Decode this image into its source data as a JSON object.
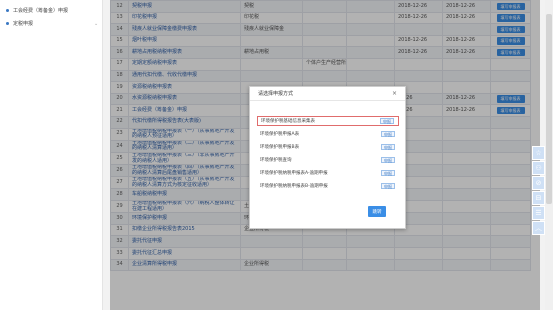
{
  "sidebar": [
    {
      "label": "工会经费（筹备金）申报",
      "chevron": ""
    },
    {
      "label": "定税申报",
      "chevron": "⌄"
    }
  ],
  "rows": [
    {
      "num": "12",
      "name": "契税申报",
      "mid": "契税",
      "mid2": "",
      "d1": "2018-12-26",
      "d2": "2018-12-26",
      "btn": "填写申报表"
    },
    {
      "num": "13",
      "name": "印花税申报",
      "mid": "印花税",
      "mid2": "",
      "d1": "2018-12-26",
      "d2": "2018-12-26",
      "btn": "填写申报表"
    },
    {
      "num": "14",
      "name": "残疾人就业保障金缴费申报表",
      "mid": "残疾人就业保障金",
      "mid2": "",
      "d1": "",
      "d2": "",
      "btn": "填写申报表"
    },
    {
      "num": "15",
      "name": "烟叶税申报",
      "mid": "",
      "mid2": "",
      "d1": "2018-12-26",
      "d2": "2018-12-26",
      "btn": "填写申报表"
    },
    {
      "num": "16",
      "name": "耕地占用税纳税申报表",
      "mid": "耕地占用税",
      "mid2": "",
      "d1": "2018-12-26",
      "d2": "2018-12-26",
      "btn": "填写申报表"
    },
    {
      "num": "17",
      "name": "定期定额纳税申报表",
      "mid": "",
      "mid2": "个体户生产经营所得",
      "d1": "",
      "d2": "",
      "btn": ""
    },
    {
      "num": "18",
      "name": "通用代扣代缴、代收代缴申报",
      "mid": "",
      "mid2": "",
      "d1": "",
      "d2": "",
      "btn": ""
    },
    {
      "num": "19",
      "name": "资源税纳税申报表",
      "mid": "",
      "mid2": "",
      "d1": "",
      "d2": "",
      "btn": ""
    },
    {
      "num": "20",
      "name": "水资源税纳税申报表",
      "mid": "",
      "mid2": "",
      "d1": "12-26",
      "d2": "2018-12-26",
      "btn": "填写申报表"
    },
    {
      "num": "21",
      "name": "工会经费（筹备金）申报",
      "mid": "",
      "mid2": "",
      "d1": "12-26",
      "d2": "2018-12-26",
      "btn": "填写申报表"
    },
    {
      "num": "22",
      "name": "代扣代缴所得税报告表(大表版)",
      "mid": "",
      "mid2": "",
      "d1": "",
      "d2": "",
      "btn": ""
    },
    {
      "num": "23",
      "name": "土地增值税纳税申报表（一）（从事房地产开发的纳税人预征适用）",
      "mid": "",
      "mid2": "",
      "d1": "",
      "d2": "",
      "btn": ""
    },
    {
      "num": "24",
      "name": "土地增值税纳税申报表（二）（从事房地产开发的纳税人清算适用）",
      "mid": "",
      "mid2": "",
      "d1": "",
      "d2": "",
      "btn": ""
    },
    {
      "num": "25",
      "name": "土地增值税纳税申报表（三）（非从事房地产开发的纳税人适用）",
      "mid": "",
      "mid2": "",
      "d1": "",
      "d2": "",
      "btn": ""
    },
    {
      "num": "26",
      "name": "土地增值税纳税申报表（四）（从事房地产开发的纳税人清算后尾盘销售适用）",
      "mid": "",
      "mid2": "",
      "d1": "",
      "d2": "",
      "btn": ""
    },
    {
      "num": "27",
      "name": "土地增值税纳税申报表（五）（从事房地产开发的纳税人清算方式为核定征收适用）",
      "mid": "",
      "mid2": "",
      "d1": "",
      "d2": "",
      "btn": ""
    },
    {
      "num": "28",
      "name": "车船税纳税申报",
      "mid": "",
      "mid2": "",
      "d1": "",
      "d2": "",
      "btn": ""
    },
    {
      "num": "29",
      "name": "土地增值税纳税申报表（六）（纳税人整体转让在建工程适用）",
      "mid": "土地增值税",
      "mid2": "整体转让在建工程",
      "d1": "",
      "d2": "",
      "btn": ""
    },
    {
      "num": "30",
      "name": "环境保护税申报",
      "mid": "环境保护税",
      "mid2": "",
      "d1": "",
      "d2": "",
      "btn": ""
    },
    {
      "num": "31",
      "name": "扣缴企业所得税报告表2015",
      "mid": "企业所得税",
      "mid2": "",
      "d1": "",
      "d2": "",
      "btn": ""
    },
    {
      "num": "32",
      "name": "委托代征申报",
      "mid": "",
      "mid2": "",
      "d1": "",
      "d2": "",
      "btn": ""
    },
    {
      "num": "33",
      "name": "委托代征汇总申报",
      "mid": "",
      "mid2": "",
      "d1": "",
      "d2": "",
      "btn": ""
    },
    {
      "num": "34",
      "name": "企业清算所得税申报",
      "mid": "企业所得税",
      "mid2": "",
      "d1": "",
      "d2": "",
      "btn": ""
    }
  ],
  "modal": {
    "title": "请选择申报方式",
    "close": "×",
    "options": [
      {
        "label": "环境保护税基础信息采集表",
        "btn": "申报"
      },
      {
        "label": "环境保护税申报A表",
        "btn": "申报"
      },
      {
        "label": "环境保护税申报B表",
        "btn": "申报"
      },
      {
        "label": "环境保护税查询",
        "btn": "申报"
      },
      {
        "label": "环境保护税纳税申报表A-逾期申报",
        "btn": "申报"
      },
      {
        "label": "环境保护税纳税申报表B-逾期申报",
        "btn": "申报"
      }
    ],
    "confirm": "跳转"
  },
  "tools": [
    "☆",
    "⚇",
    "⊘",
    "⊟",
    "☰",
    "︿"
  ]
}
